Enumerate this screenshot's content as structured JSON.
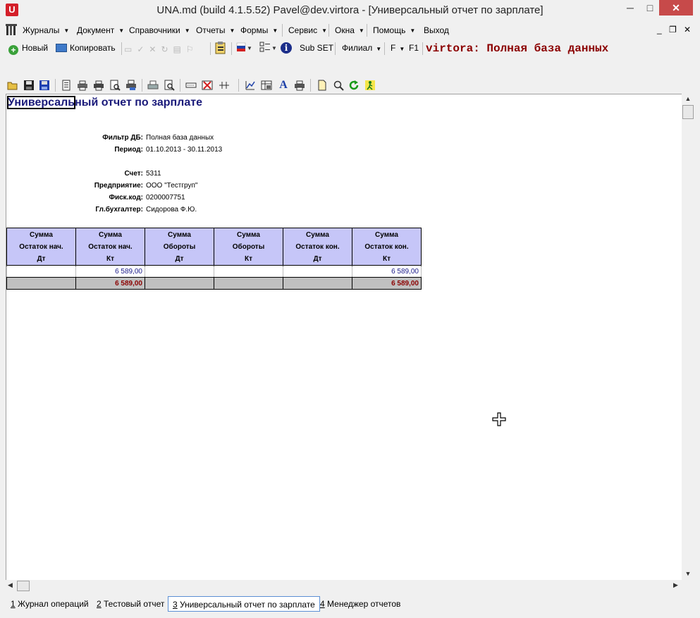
{
  "window": {
    "title": "UNA.md (build 4.1.5.52) Pavel@dev.virtora - [Универсальный отчет по зарплате]",
    "app_icon_letter": "U",
    "controls": {
      "minimize": "─",
      "maximize": "□",
      "close": "✕"
    }
  },
  "menu": {
    "items": [
      {
        "label": "Журналы",
        "has_arrow": true
      },
      {
        "label": "Документ",
        "has_arrow": true
      },
      {
        "label": "Справочники",
        "has_arrow": true
      },
      {
        "label": "Отчеты",
        "has_arrow": true
      },
      {
        "label": "Формы",
        "has_arrow": true
      },
      {
        "label": "Сервис",
        "has_arrow": true
      },
      {
        "label": "Окна",
        "has_arrow": true
      },
      {
        "label": "Помощь",
        "has_arrow": true
      },
      {
        "label": "Выход",
        "has_arrow": false
      }
    ],
    "mdi_controls": {
      "minimize": "_",
      "restore": "❐",
      "close": "✕"
    }
  },
  "toolbar": {
    "new_label": "Новый",
    "copy_label": "Копировать",
    "subset_label": "Sub SET",
    "branch_label": "Филиал",
    "f_label": "F",
    "f1_label": "F1",
    "db_title": "virtora: Полная база данных"
  },
  "report": {
    "title": "Универсальный отчет по зарплате",
    "title_highlight": "Универсаль",
    "title_rest": "ный отчет по зарплате",
    "meta": [
      {
        "label": "Фильтр ДБ:",
        "value": "Полная база данных"
      },
      {
        "label": "Период:",
        "value": "01.10.2013 - 30.11.2013"
      },
      {
        "label": "Счет:",
        "value": "5311"
      },
      {
        "label": "Предприятие:",
        "value": "ООО \"Тестгруп\""
      },
      {
        "label": "Фиск.код:",
        "value": "0200007751"
      },
      {
        "label": "Гл.бухгалтер:",
        "value": "Сидорова Ф.Ю."
      }
    ],
    "columns": [
      [
        "Сумма",
        "Остаток нач.",
        "Дт"
      ],
      [
        "Сумма",
        "Остаток нач.",
        "Кт"
      ],
      [
        "Сумма",
        "Обороты",
        "Дт"
      ],
      [
        "Сумма",
        "Обороты",
        "Кт"
      ],
      [
        "Сумма",
        "Остаток кон.",
        "Дт"
      ],
      [
        "Сумма",
        "Остаток кон.",
        "Кт"
      ]
    ],
    "rows": [
      [
        "",
        "6 589,00",
        "",
        "",
        "",
        "6 589,00"
      ]
    ],
    "total": [
      "",
      "6 589,00",
      "",
      "",
      "",
      "6 589,00"
    ]
  },
  "tabs": [
    {
      "num": "1",
      "label": " Журнал операций",
      "active": false
    },
    {
      "num": "2",
      "label": " Тестовый отчет",
      "active": false
    },
    {
      "num": "3",
      "label": " Универсальный отчет по зарплате",
      "active": true
    },
    {
      "num": "4",
      "label": " Менеджер отчетов",
      "active": false
    }
  ],
  "colors": {
    "accent_title": "#1a1a7a",
    "db_title": "#8b0000",
    "header_bg": "#c6c6f8",
    "total_bg": "#c0c0c0"
  }
}
